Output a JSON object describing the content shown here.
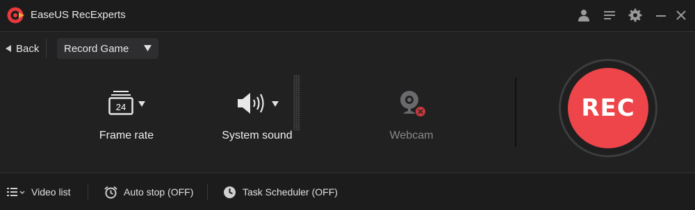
{
  "app": {
    "title": "EaseUS RecExperts"
  },
  "titlebar": {
    "icons": [
      "account-icon",
      "menu-icon",
      "settings-icon",
      "minimize-icon",
      "close-icon"
    ]
  },
  "nav": {
    "back_label": "Back",
    "mode_selected": "Record Game"
  },
  "panels": {
    "frame_rate": {
      "label": "Frame rate",
      "value": "24"
    },
    "system_sound": {
      "label": "System sound"
    },
    "webcam": {
      "label": "Webcam"
    }
  },
  "rec": {
    "label": "REC"
  },
  "footer": {
    "video_list": "Video list",
    "auto_stop": "Auto stop (OFF)",
    "task_scheduler": "Task Scheduler (OFF)"
  },
  "colors": {
    "accent": "#ed4549",
    "background": "#212122",
    "bar": "#1c1c1d",
    "disabled_text": "#8a8a8c"
  }
}
